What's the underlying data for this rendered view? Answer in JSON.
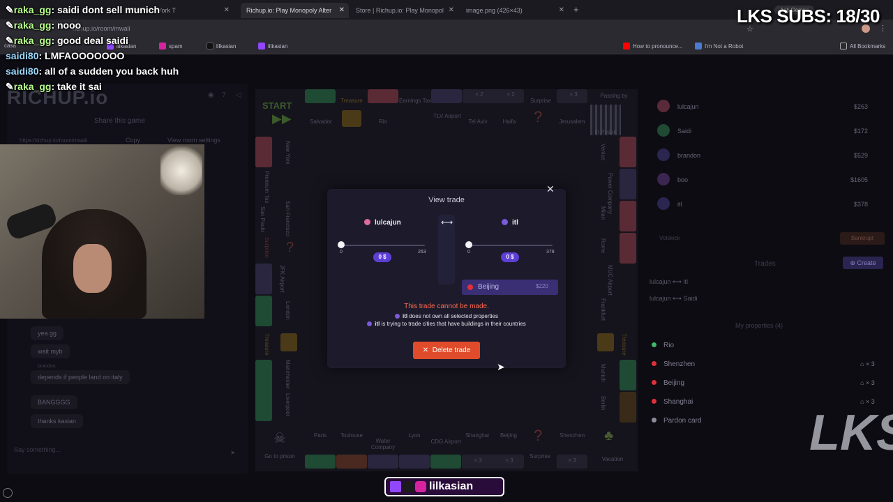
{
  "browser": {
    "tabs": [
      {
        "label": "The New York T",
        "active": false
      },
      {
        "label": "Richup.io: Play Monopoly Alter",
        "active": true
      },
      {
        "label": "Store | Richup.io: Play Monopol",
        "active": false
      },
      {
        "label": "image.png (426×43)",
        "active": false
      }
    ],
    "url": "richup.io/room/mwali",
    "ask_gemini": "Ask Gemini",
    "bookmarks": [
      "casa",
      "lilkasian",
      "spam",
      "lilkasian",
      "lilkasian",
      "How to pronounce...",
      "I'm Not a Robot",
      "All Bookmarks"
    ]
  },
  "stream_overlay": {
    "subs_counter": "LKS SUBS: 18/30",
    "chat": [
      {
        "user": "raka_gg",
        "text": "saidi dont sell munich"
      },
      {
        "user": "raka_gg",
        "text": "nooo"
      },
      {
        "user": "raka_gg",
        "text": "good deal saidi"
      },
      {
        "user": "saidi80",
        "text": "LMFAOOOOOOO"
      },
      {
        "user": "saidi80",
        "text": "all of a sudden you back huh"
      },
      {
        "user": "raka_gg",
        "text": "take it sai"
      }
    ],
    "social_handle": "lilkasian",
    "corner_logo": "LKS"
  },
  "left_panel": {
    "logo": "RICHUP.io",
    "share_title": "Share this game",
    "share_url": "https://richup.io/room/mwali",
    "copy_label": "Copy",
    "room_settings_label": "View room settings",
    "chat_messages": [
      "yea gg",
      "wait myb",
      "depends if people land on italy",
      "BANGGGG",
      "thanks kasian"
    ],
    "chat_sender": "brandon",
    "chat_placeholder": "Say something..."
  },
  "board": {
    "top_row": [
      "START",
      "Salvador",
      "Treasure",
      "Rio",
      "Earnings Tax",
      "TLV Airport",
      "Tel Aviv",
      "Haifa",
      "Surprise",
      "Jerusalem",
      "In Prison"
    ],
    "bottom_row": [
      "Go to prison",
      "Paris",
      "Toulouse",
      "Water Company",
      "Lyon",
      "CDG Airport",
      "Shanghai",
      "Beijing",
      "Surprise",
      "Shenzhen",
      "Vacation"
    ],
    "left_col": [
      "New York",
      "Premium Tax",
      "Sao Paulo",
      "San Francisco",
      "Surprise",
      "JFK Airport",
      "London",
      "Treasure",
      "Manchester",
      "Liverpool"
    ],
    "right_col": [
      "Venice",
      "Power Company",
      "Milan",
      "Rome",
      "MUC Airport",
      "Frankfurt",
      "Treasure",
      "Munich",
      "Berlin"
    ],
    "passing_by": "Passing by",
    "multiplier": "× 2",
    "multiplier3": "× 3"
  },
  "trade_modal": {
    "title": "View trade",
    "left_player": "lulcajun",
    "right_player": "itl",
    "left_slider_min": "0",
    "left_slider_max": "263",
    "right_slider_min": "0",
    "right_slider_max": "378",
    "left_amount": "0 $",
    "right_amount": "0 $",
    "left_amount_fraction": 0,
    "right_amount_fraction": 0,
    "property": {
      "name": "Beijing",
      "price": "$220"
    },
    "error_title": "This trade cannot be made.",
    "errors": [
      {
        "player": "itl",
        "text": "does not own all selected properties"
      },
      {
        "player": "itl",
        "text": "is trying to trade cities that have buildings in their countries"
      }
    ],
    "delete_label": "Delete trade"
  },
  "right_panel": {
    "players": [
      {
        "name": "lulcajun",
        "money": "$263",
        "color": "#e06a9a"
      },
      {
        "name": "Saidi",
        "money": "$172",
        "color": "#3fb66b"
      },
      {
        "name": "brandon",
        "money": "$529",
        "color": "#6b5be0"
      },
      {
        "name": "boo",
        "money": "$1605",
        "color": "#b45be0"
      },
      {
        "name": "itl",
        "money": "$378",
        "color": "#7a5bd8"
      }
    ],
    "votekick": "Votekick",
    "bankrupt": "Bankrupt",
    "trades_title": "Trades",
    "create_label": "Create",
    "trades": [
      {
        "from": "lulcajun",
        "to": "itl"
      },
      {
        "from": "lulcajun",
        "to": "Saidi"
      }
    ],
    "my_properties_title": "My properties (4)",
    "properties": [
      {
        "name": "Rio",
        "extra": "",
        "color": "#3fb66b"
      },
      {
        "name": "Shenzhen",
        "extra": "× 3",
        "color": "#e0303a"
      },
      {
        "name": "Beijing",
        "extra": "× 3",
        "color": "#e0303a"
      },
      {
        "name": "Shanghai",
        "extra": "× 3",
        "color": "#e0303a"
      },
      {
        "name": "Pardon card",
        "extra": "",
        "color": "#8e8d9a"
      }
    ]
  },
  "colors": {
    "accent": "#5d3fd6",
    "danger": "#e04c2b",
    "error_text": "#ff6a4f",
    "modal_bg": "#1d1b2b"
  }
}
